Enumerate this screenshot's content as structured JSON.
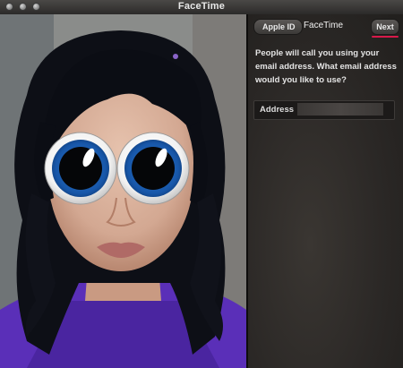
{
  "window": {
    "title": "FaceTime"
  },
  "icons": {
    "close": "traffic-light-close",
    "minimize": "traffic-light-minimize",
    "zoom": "traffic-light-zoom"
  },
  "panel": {
    "back_label": "Apple ID",
    "title": "FaceTime",
    "next_label": "Next",
    "prompt": "People will call you using your email address. What email address would you like to use?",
    "address_label": "Address",
    "address_value": "",
    "address_placeholder": ""
  },
  "colors": {
    "accent": "#d8194a",
    "panel_bg": "#2b2826",
    "text": "#e4e4e4"
  }
}
